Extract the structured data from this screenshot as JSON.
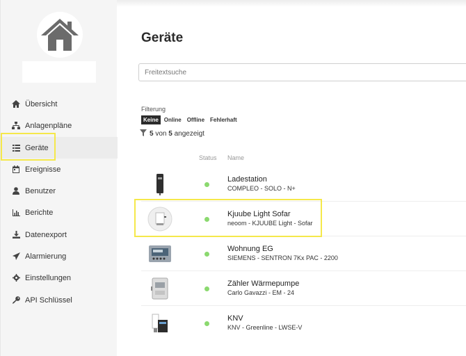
{
  "sidebar": {
    "items": [
      {
        "label": "Übersicht",
        "icon": "home-icon"
      },
      {
        "label": "Anlagenpläne",
        "icon": "sitemap-icon"
      },
      {
        "label": "Geräte",
        "icon": "list-icon",
        "active": true
      },
      {
        "label": "Ereignisse",
        "icon": "calendar-icon"
      },
      {
        "label": "Benutzer",
        "icon": "user-icon"
      },
      {
        "label": "Berichte",
        "icon": "chart-icon"
      },
      {
        "label": "Datenexport",
        "icon": "download-icon"
      },
      {
        "label": "Alarmierung",
        "icon": "send-icon"
      },
      {
        "label": "Einstellungen",
        "icon": "gear-icon"
      },
      {
        "label": "API Schlüssel",
        "icon": "key-icon"
      }
    ]
  },
  "main": {
    "title": "Geräte",
    "search": {
      "placeholder": "Freitextsuche",
      "value": ""
    },
    "filter": {
      "label": "Filterung",
      "options": [
        "Keine",
        "Online",
        "Offline",
        "Fehlerhaft"
      ],
      "selected": "Keine"
    },
    "count": {
      "shown": "5",
      "von": "von",
      "total": "5",
      "suffix": "angezeigt"
    },
    "columns": {
      "status": "Status",
      "name": "Name"
    },
    "devices": [
      {
        "name": "Ladestation",
        "sub": "COMPLEO - SOLO - N+",
        "status": "online",
        "image": "wallbox"
      },
      {
        "name": "Kjuube Light Sofar",
        "sub": "neoom - KJUUBE Light - Sofar",
        "status": "online",
        "image": "battery-cube"
      },
      {
        "name": "Wohnung EG",
        "sub": "SIEMENS - SENTRON 7Kx PAC - 2200",
        "status": "online",
        "image": "meter-panel"
      },
      {
        "name": "Zähler Wärmepumpe",
        "sub": "Carlo Gavazzi - EM - 24",
        "status": "online",
        "image": "din-meter"
      },
      {
        "name": "KNV",
        "sub": "KNV - Greenline - LWSE-V",
        "status": "online",
        "image": "heat-pump"
      }
    ]
  },
  "colors": {
    "accent_highlight": "#f5e84a",
    "status_online": "#8bd96f",
    "sidebar_bg": "#f5f5f5"
  }
}
